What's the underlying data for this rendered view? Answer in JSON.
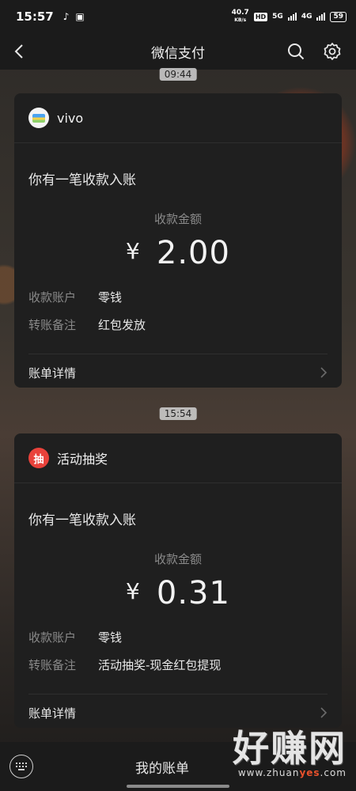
{
  "status_bar": {
    "time": "15:57",
    "net_speed_value": "40.7",
    "net_speed_unit": "KB/s",
    "hd_badge": "HD",
    "network_5g": "5G",
    "network_4g": "4G",
    "battery": "59"
  },
  "nav": {
    "title": "微信支付"
  },
  "messages": [
    {
      "time": "09:44",
      "sender": "vivo",
      "headline": "你有一笔收款入账",
      "amount_label": "收款金额",
      "currency_symbol": "¥",
      "amount": "2.00",
      "rows": [
        {
          "key": "收款账户",
          "value": "零钱"
        },
        {
          "key": "转账备注",
          "value": "红包发放"
        }
      ],
      "details_label": "账单详情"
    },
    {
      "time": "15:54",
      "sender": "活动抽奖",
      "logo_text": "抽",
      "headline": "你有一笔收款入账",
      "amount_label": "收款金额",
      "currency_symbol": "¥",
      "amount": "0.31",
      "rows": [
        {
          "key": "收款账户",
          "value": "零钱"
        },
        {
          "key": "转账备注",
          "value": "活动抽奖-现金红包提现"
        }
      ],
      "details_label": "账单详情"
    }
  ],
  "bottom_bar": {
    "menu_label": "我的账单"
  },
  "watermark": {
    "main": "好赚网",
    "sub_prefix": "www.zhuan",
    "sub_highlight": "yes",
    "sub_suffix": ".com"
  },
  "colors": {
    "card_background": "#1f1f1f",
    "bar_background": "#1b1b1b",
    "lottery_logo": "#e9423b",
    "watermark_accent": "#e8512c"
  },
  "icons": [
    "back-arrow-icon",
    "search-icon",
    "gear-icon",
    "chevron-right-icon",
    "keyboard-icon",
    "vivo-wallet-icon",
    "lottery-icon"
  ]
}
